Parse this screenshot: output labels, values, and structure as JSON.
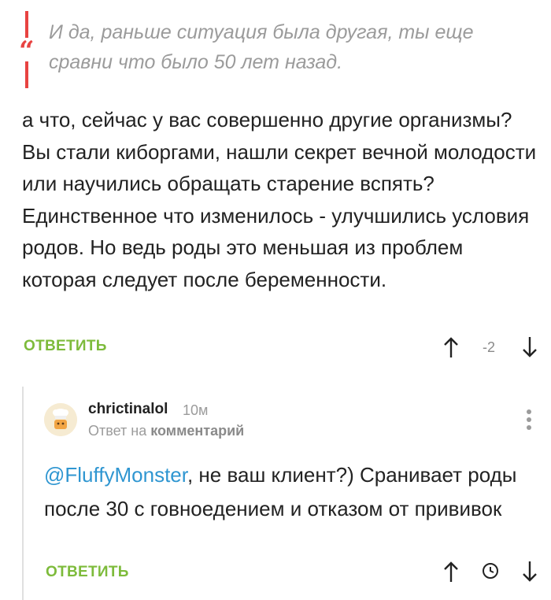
{
  "quote": {
    "text": "И да, раньше ситуация была другая, ты еще сравни что было 50 лет назад.",
    "accent_color": "#e84341"
  },
  "comment_main": {
    "text": "а что, сейчас у вас совершенно другие организмы? Вы стали киборгами, нашли секрет вечной молодости или научились обращать старение вспять? Единственное что изменилось - улучшились условия родов. Но ведь роды это меньшая из проблем которая следует после беременности.",
    "reply_label": "ОТВЕТИТЬ",
    "rating": "-2",
    "icons": [
      "arrow-up-icon",
      "arrow-down-icon"
    ]
  },
  "reply_comment": {
    "username": "chrictinalol",
    "time": "10м",
    "reply_to_prefix": "Ответ на",
    "reply_to_target": "комментарий",
    "mention": "@FluffyMonster",
    "text": ", не ваш клиент?) Сранивает роды после 30 с говноедением и отказом от прививок",
    "reply_label": "ОТВЕТИТЬ",
    "icons": [
      "arrow-up-icon",
      "clock-icon",
      "arrow-down-icon",
      "more-dots-icon"
    ]
  },
  "colors": {
    "reply_link": "#7dbb3b",
    "mention": "#2f96d1",
    "muted": "#9b9b9b"
  }
}
